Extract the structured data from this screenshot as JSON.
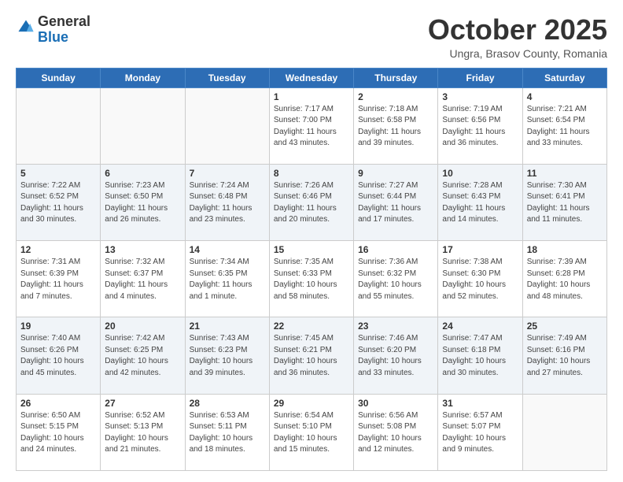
{
  "header": {
    "logo_general": "General",
    "logo_blue": "Blue",
    "month": "October 2025",
    "location": "Ungra, Brasov County, Romania"
  },
  "weekdays": [
    "Sunday",
    "Monday",
    "Tuesday",
    "Wednesday",
    "Thursday",
    "Friday",
    "Saturday"
  ],
  "weeks": [
    [
      {
        "day": "",
        "sunrise": "",
        "sunset": "",
        "daylight": ""
      },
      {
        "day": "",
        "sunrise": "",
        "sunset": "",
        "daylight": ""
      },
      {
        "day": "",
        "sunrise": "",
        "sunset": "",
        "daylight": ""
      },
      {
        "day": "1",
        "sunrise": "Sunrise: 7:17 AM",
        "sunset": "Sunset: 7:00 PM",
        "daylight": "Daylight: 11 hours and 43 minutes."
      },
      {
        "day": "2",
        "sunrise": "Sunrise: 7:18 AM",
        "sunset": "Sunset: 6:58 PM",
        "daylight": "Daylight: 11 hours and 39 minutes."
      },
      {
        "day": "3",
        "sunrise": "Sunrise: 7:19 AM",
        "sunset": "Sunset: 6:56 PM",
        "daylight": "Daylight: 11 hours and 36 minutes."
      },
      {
        "day": "4",
        "sunrise": "Sunrise: 7:21 AM",
        "sunset": "Sunset: 6:54 PM",
        "daylight": "Daylight: 11 hours and 33 minutes."
      }
    ],
    [
      {
        "day": "5",
        "sunrise": "Sunrise: 7:22 AM",
        "sunset": "Sunset: 6:52 PM",
        "daylight": "Daylight: 11 hours and 30 minutes."
      },
      {
        "day": "6",
        "sunrise": "Sunrise: 7:23 AM",
        "sunset": "Sunset: 6:50 PM",
        "daylight": "Daylight: 11 hours and 26 minutes."
      },
      {
        "day": "7",
        "sunrise": "Sunrise: 7:24 AM",
        "sunset": "Sunset: 6:48 PM",
        "daylight": "Daylight: 11 hours and 23 minutes."
      },
      {
        "day": "8",
        "sunrise": "Sunrise: 7:26 AM",
        "sunset": "Sunset: 6:46 PM",
        "daylight": "Daylight: 11 hours and 20 minutes."
      },
      {
        "day": "9",
        "sunrise": "Sunrise: 7:27 AM",
        "sunset": "Sunset: 6:44 PM",
        "daylight": "Daylight: 11 hours and 17 minutes."
      },
      {
        "day": "10",
        "sunrise": "Sunrise: 7:28 AM",
        "sunset": "Sunset: 6:43 PM",
        "daylight": "Daylight: 11 hours and 14 minutes."
      },
      {
        "day": "11",
        "sunrise": "Sunrise: 7:30 AM",
        "sunset": "Sunset: 6:41 PM",
        "daylight": "Daylight: 11 hours and 11 minutes."
      }
    ],
    [
      {
        "day": "12",
        "sunrise": "Sunrise: 7:31 AM",
        "sunset": "Sunset: 6:39 PM",
        "daylight": "Daylight: 11 hours and 7 minutes."
      },
      {
        "day": "13",
        "sunrise": "Sunrise: 7:32 AM",
        "sunset": "Sunset: 6:37 PM",
        "daylight": "Daylight: 11 hours and 4 minutes."
      },
      {
        "day": "14",
        "sunrise": "Sunrise: 7:34 AM",
        "sunset": "Sunset: 6:35 PM",
        "daylight": "Daylight: 11 hours and 1 minute."
      },
      {
        "day": "15",
        "sunrise": "Sunrise: 7:35 AM",
        "sunset": "Sunset: 6:33 PM",
        "daylight": "Daylight: 10 hours and 58 minutes."
      },
      {
        "day": "16",
        "sunrise": "Sunrise: 7:36 AM",
        "sunset": "Sunset: 6:32 PM",
        "daylight": "Daylight: 10 hours and 55 minutes."
      },
      {
        "day": "17",
        "sunrise": "Sunrise: 7:38 AM",
        "sunset": "Sunset: 6:30 PM",
        "daylight": "Daylight: 10 hours and 52 minutes."
      },
      {
        "day": "18",
        "sunrise": "Sunrise: 7:39 AM",
        "sunset": "Sunset: 6:28 PM",
        "daylight": "Daylight: 10 hours and 48 minutes."
      }
    ],
    [
      {
        "day": "19",
        "sunrise": "Sunrise: 7:40 AM",
        "sunset": "Sunset: 6:26 PM",
        "daylight": "Daylight: 10 hours and 45 minutes."
      },
      {
        "day": "20",
        "sunrise": "Sunrise: 7:42 AM",
        "sunset": "Sunset: 6:25 PM",
        "daylight": "Daylight: 10 hours and 42 minutes."
      },
      {
        "day": "21",
        "sunrise": "Sunrise: 7:43 AM",
        "sunset": "Sunset: 6:23 PM",
        "daylight": "Daylight: 10 hours and 39 minutes."
      },
      {
        "day": "22",
        "sunrise": "Sunrise: 7:45 AM",
        "sunset": "Sunset: 6:21 PM",
        "daylight": "Daylight: 10 hours and 36 minutes."
      },
      {
        "day": "23",
        "sunrise": "Sunrise: 7:46 AM",
        "sunset": "Sunset: 6:20 PM",
        "daylight": "Daylight: 10 hours and 33 minutes."
      },
      {
        "day": "24",
        "sunrise": "Sunrise: 7:47 AM",
        "sunset": "Sunset: 6:18 PM",
        "daylight": "Daylight: 10 hours and 30 minutes."
      },
      {
        "day": "25",
        "sunrise": "Sunrise: 7:49 AM",
        "sunset": "Sunset: 6:16 PM",
        "daylight": "Daylight: 10 hours and 27 minutes."
      }
    ],
    [
      {
        "day": "26",
        "sunrise": "Sunrise: 6:50 AM",
        "sunset": "Sunset: 5:15 PM",
        "daylight": "Daylight: 10 hours and 24 minutes."
      },
      {
        "day": "27",
        "sunrise": "Sunrise: 6:52 AM",
        "sunset": "Sunset: 5:13 PM",
        "daylight": "Daylight: 10 hours and 21 minutes."
      },
      {
        "day": "28",
        "sunrise": "Sunrise: 6:53 AM",
        "sunset": "Sunset: 5:11 PM",
        "daylight": "Daylight: 10 hours and 18 minutes."
      },
      {
        "day": "29",
        "sunrise": "Sunrise: 6:54 AM",
        "sunset": "Sunset: 5:10 PM",
        "daylight": "Daylight: 10 hours and 15 minutes."
      },
      {
        "day": "30",
        "sunrise": "Sunrise: 6:56 AM",
        "sunset": "Sunset: 5:08 PM",
        "daylight": "Daylight: 10 hours and 12 minutes."
      },
      {
        "day": "31",
        "sunrise": "Sunrise: 6:57 AM",
        "sunset": "Sunset: 5:07 PM",
        "daylight": "Daylight: 10 hours and 9 minutes."
      },
      {
        "day": "",
        "sunrise": "",
        "sunset": "",
        "daylight": ""
      }
    ]
  ]
}
